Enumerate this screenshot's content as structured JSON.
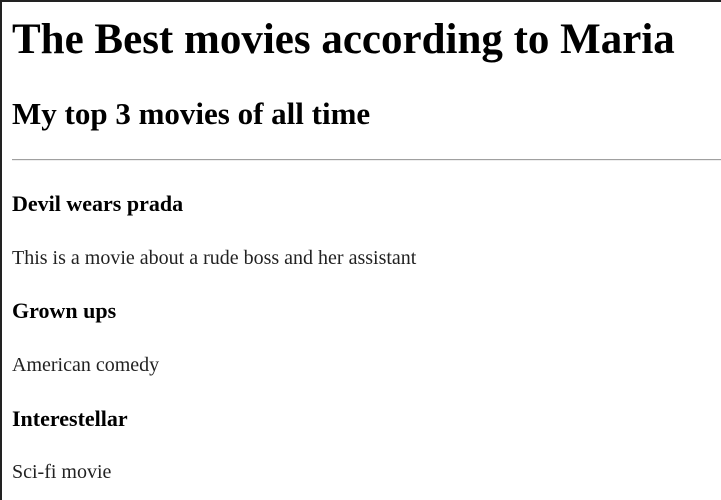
{
  "page": {
    "title": "The Best movies according to Maria",
    "subtitle": "My top 3 movies of all time"
  },
  "movies": [
    {
      "title": "Devil wears prada",
      "description": "This is a movie about a rude boss and her assistant"
    },
    {
      "title": "Grown ups",
      "description": "American comedy"
    },
    {
      "title": "Interestellar",
      "description": "Sci-fi movie"
    }
  ]
}
